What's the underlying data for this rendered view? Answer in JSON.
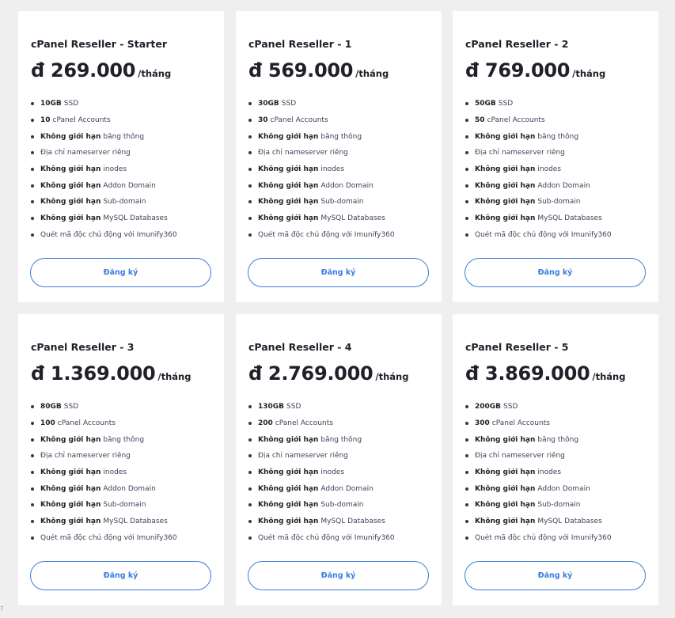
{
  "plans": [
    {
      "name": "cPanel Reseller - Starter",
      "price": "đ 269.000",
      "period": "/tháng",
      "features": [
        {
          "bold": "10GB",
          "text": "SSD"
        },
        {
          "bold": "10",
          "text": "cPanel Accounts"
        },
        {
          "bold": "Không giới hạn",
          "text": "băng thông"
        },
        {
          "bold": "",
          "text": "Địa chỉ nameserver riêng"
        },
        {
          "bold": "Không giới hạn",
          "text": "inodes"
        },
        {
          "bold": "Không giới hạn",
          "text": "Addon Domain"
        },
        {
          "bold": "Không giới hạn",
          "text": "Sub-domain"
        },
        {
          "bold": "Không giới hạn",
          "text": "MySQL Databases"
        },
        {
          "bold": "",
          "text": "Quét mã độc chủ động với Imunify360"
        }
      ],
      "button": "Đăng ký"
    },
    {
      "name": "cPanel Reseller - 1",
      "price": "đ 569.000",
      "period": "/tháng",
      "features": [
        {
          "bold": "30GB",
          "text": "SSD"
        },
        {
          "bold": "30",
          "text": "cPanel Accounts"
        },
        {
          "bold": "Không giới hạn",
          "text": "băng thông"
        },
        {
          "bold": "",
          "text": "Địa chỉ nameserver riêng"
        },
        {
          "bold": "Không giới hạn",
          "text": "inodes"
        },
        {
          "bold": "Không giới hạn",
          "text": "Addon Domain"
        },
        {
          "bold": "Không giới hạn",
          "text": "Sub-domain"
        },
        {
          "bold": "Không giới hạn",
          "text": "MySQL Databases"
        },
        {
          "bold": "",
          "text": "Quét mã độc chủ động với Imunify360"
        }
      ],
      "button": "Đăng ký"
    },
    {
      "name": "cPanel Reseller - 2",
      "price": "đ 769.000",
      "period": "/tháng",
      "features": [
        {
          "bold": "50GB",
          "text": "SSD"
        },
        {
          "bold": "50",
          "text": "cPanel Accounts"
        },
        {
          "bold": "Không giới hạn",
          "text": "băng thông"
        },
        {
          "bold": "",
          "text": "Địa chỉ nameserver riêng"
        },
        {
          "bold": "Không giới hạn",
          "text": "inodes"
        },
        {
          "bold": "Không giới hạn",
          "text": "Addon Domain"
        },
        {
          "bold": "Không giới hạn",
          "text": "Sub-domain"
        },
        {
          "bold": "Không giới hạn",
          "text": "MySQL Databases"
        },
        {
          "bold": "",
          "text": "Quét mã độc chủ động với Imunify360"
        }
      ],
      "button": "Đăng ký"
    },
    {
      "name": "cPanel Reseller - 3",
      "price": "đ 1.369.000",
      "period": "/tháng",
      "features": [
        {
          "bold": "80GB",
          "text": "SSD"
        },
        {
          "bold": "100",
          "text": "cPanel Accounts"
        },
        {
          "bold": "Không giới hạn",
          "text": "băng thông"
        },
        {
          "bold": "",
          "text": "Địa chỉ nameserver riêng"
        },
        {
          "bold": "Không giới hạn",
          "text": "inodes"
        },
        {
          "bold": "Không giới hạn",
          "text": "Addon Domain"
        },
        {
          "bold": "Không giới hạn",
          "text": "Sub-domain"
        },
        {
          "bold": "Không giới hạn",
          "text": "MySQL Databases"
        },
        {
          "bold": "",
          "text": "Quét mã độc chủ động với Imunify360"
        }
      ],
      "button": "Đăng ký"
    },
    {
      "name": "cPanel Reseller - 4",
      "price": "đ 2.769.000",
      "period": "/tháng",
      "features": [
        {
          "bold": "130GB",
          "text": "SSD"
        },
        {
          "bold": "200",
          "text": "cPanel Accounts"
        },
        {
          "bold": "Không giới hạn",
          "text": "băng thông"
        },
        {
          "bold": "",
          "text": "Địa chỉ nameserver riêng"
        },
        {
          "bold": "Không giới hạn",
          "text": "inodes"
        },
        {
          "bold": "Không giới hạn",
          "text": "Addon Domain"
        },
        {
          "bold": "Không giới hạn",
          "text": "Sub-domain"
        },
        {
          "bold": "Không giới hạn",
          "text": "MySQL Databases"
        },
        {
          "bold": "",
          "text": "Quét mã độc chủ động với Imunify360"
        }
      ],
      "button": "Đăng ký"
    },
    {
      "name": "cPanel Reseller - 5",
      "price": "đ 3.869.000",
      "period": "/tháng",
      "features": [
        {
          "bold": "200GB",
          "text": "SSD"
        },
        {
          "bold": "300",
          "text": "cPanel Accounts"
        },
        {
          "bold": "Không giới hạn",
          "text": "băng thông"
        },
        {
          "bold": "",
          "text": "Địa chỉ nameserver riêng"
        },
        {
          "bold": "Không giới hạn",
          "text": "inodes"
        },
        {
          "bold": "Không giới hạn",
          "text": "Addon Domain"
        },
        {
          "bold": "Không giới hạn",
          "text": "Sub-domain"
        },
        {
          "bold": "Không giới hạn",
          "text": "MySQL Databases"
        },
        {
          "bold": "",
          "text": "Quét mã độc chủ động với Imunify360"
        }
      ],
      "button": "Đăng ký"
    }
  ],
  "corner_mark": "?"
}
